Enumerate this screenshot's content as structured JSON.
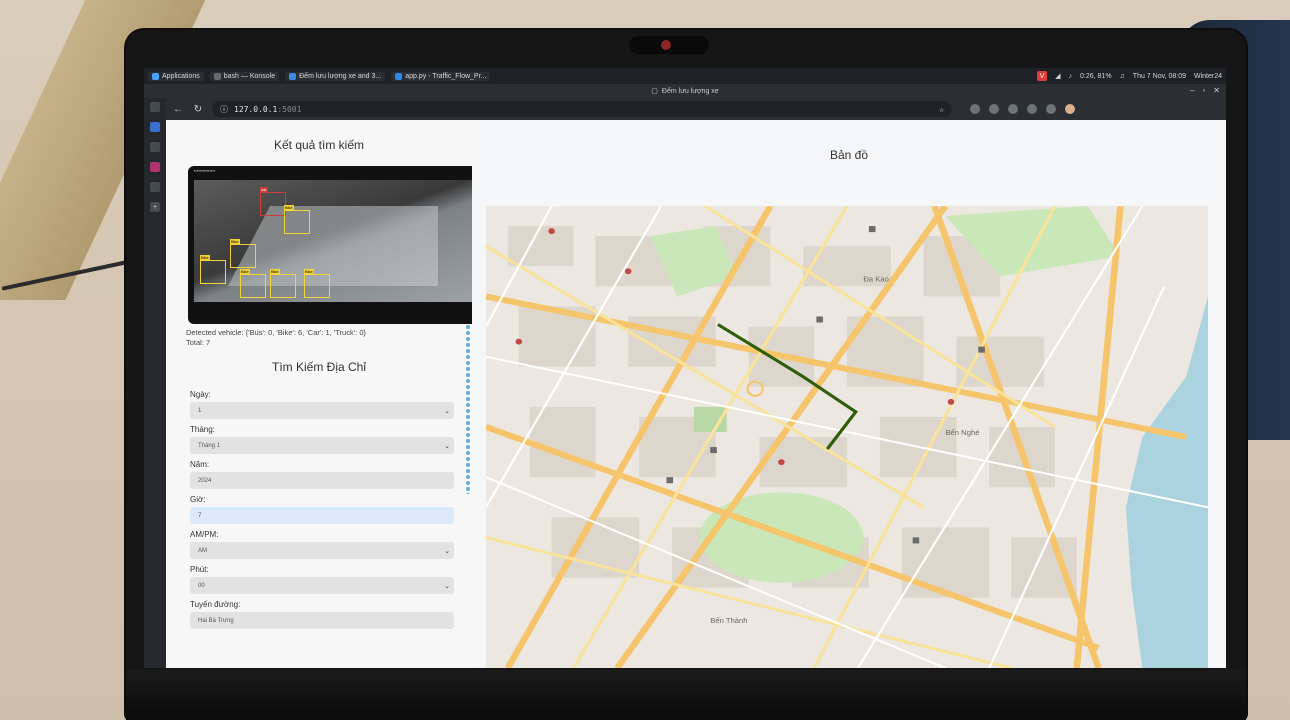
{
  "taskbar": {
    "apps_label": "Applications",
    "items": [
      {
        "label": "bash — Konsole"
      },
      {
        "label": "Đếm lưu lượng xe and 3..."
      },
      {
        "label": "app.py - Traffic_Flow_Pr..."
      }
    ],
    "battery": "0:26, 81%",
    "datetime": "Thu 7 Nov, 08:09",
    "user": "Winter24"
  },
  "browser": {
    "tab_title": "Đếm lưu lượng xe",
    "url_host": "127.0.0.1",
    "url_port": ":5001"
  },
  "results": {
    "heading": "Kết quả tìm kiếm",
    "detected": "Detected vehicle: {'Bus': 0, 'Bike': 6, 'Car': 1, 'Truck': 0}",
    "total": "Total: 7",
    "det_label": "Bike",
    "det_label_car": "car"
  },
  "form": {
    "heading": "Tìm Kiếm Địa Chỉ",
    "fields": [
      {
        "label": "Ngày:",
        "value": "1"
      },
      {
        "label": "Tháng:",
        "value": "Tháng 1"
      },
      {
        "label": "Năm:",
        "value": "2024"
      },
      {
        "label": "Giờ:",
        "value": "7"
      },
      {
        "label": "AM/PM:",
        "value": "AM"
      },
      {
        "label": "Phút:",
        "value": "00"
      },
      {
        "label": "Tuyến đường:",
        "value": "Hai Bà Trưng"
      }
    ]
  },
  "map": {
    "heading": "Bản đồ",
    "route_color": "#2f5d0a",
    "park_color": "#c9e7b8",
    "river_color": "#aad3df",
    "labels": [
      "Bến Nghé",
      "Đa Kao",
      "Bến Thành"
    ]
  }
}
